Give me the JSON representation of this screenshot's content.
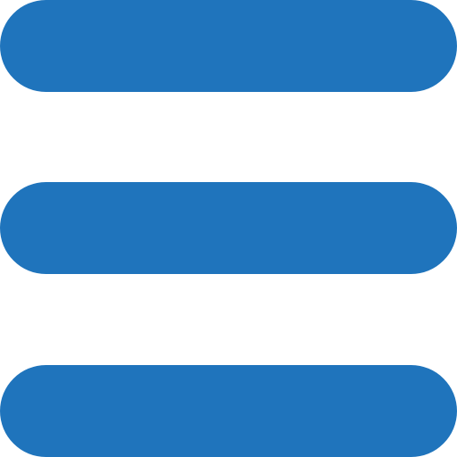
{
  "icon": {
    "name": "hamburger-menu-icon",
    "color": "#1f74bc",
    "bar_count": 3
  }
}
